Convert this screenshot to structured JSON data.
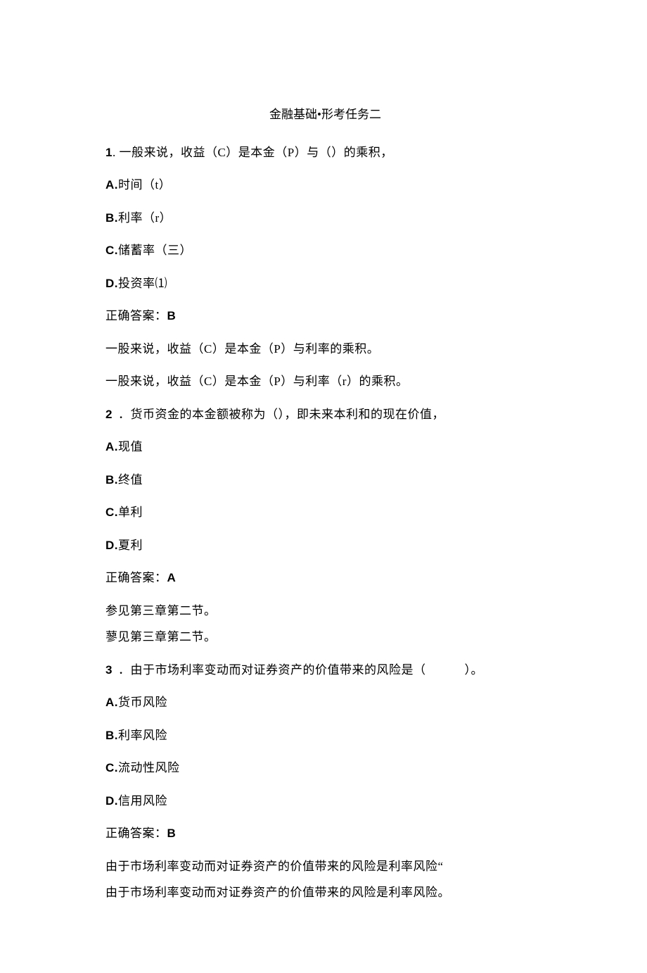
{
  "title": "金融基础•形考任务二",
  "q1": {
    "prompt_pre": "1",
    "prompt_text": ". 一般来说，收益（C）是本金（P）与（）的乘积，",
    "a_label": "A.",
    "a_text": "时间（t）",
    "b_label": "B.",
    "b_text": "利率（r）",
    "c_label": "C.",
    "c_text": "储蓄率（三）",
    "d_label": "D.",
    "d_text": "投资率⑴",
    "answer_label": "正确答案：",
    "answer_value": "B",
    "exp1": "一股来说，收益（C）是本金（P）与利率的乘积。",
    "exp2": "一股来说，收益（C）是本金（P）与利率（r）的乘积。"
  },
  "q2": {
    "num": "2",
    "prompt_text": "．货币资金的本金额被称为（），即未来本利和的现在价值，",
    "a_label": "A.",
    "a_text": "现值",
    "b_label": "B.",
    "b_text": "终值",
    "c_label": "C.",
    "c_text": "单利",
    "d_label": "D.",
    "d_text": "夏利",
    "answer_label": "正确答案：",
    "answer_value": "A",
    "exp1": "参见第三章第二节。",
    "exp2": "蓼见第三章第二节。"
  },
  "q3": {
    "num": "3",
    "prompt_text_pre": "．由于市场利率变动而对证券资产的价值带来的风险是（",
    "prompt_text_post": "）。",
    "a_label": "A.",
    "a_text": "货币风险",
    "b_label": "B.",
    "b_text": "利率风险",
    "c_label": "C.",
    "c_text": "流动性风险",
    "d_label": "D.",
    "d_text": "信用风险",
    "answer_label": "正确答案：",
    "answer_value": "B",
    "exp1": "由于市场利率变动而对证券资产的价值带来的风险是利率风险“",
    "exp2": "由于市场利率变动而对证券资产的价值带来的风险是利率风险。"
  }
}
